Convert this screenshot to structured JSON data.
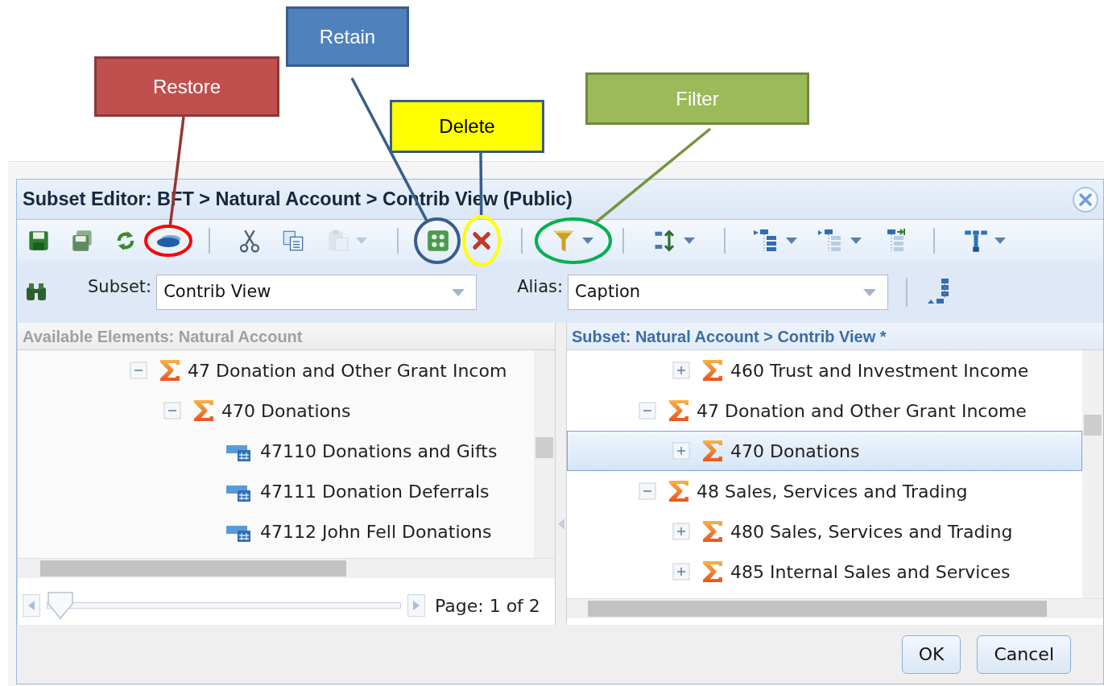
{
  "window": {
    "title": "Subset Editor: BFT > Natural Account > Contrib View (Public)"
  },
  "toolbar": [
    {
      "kind": "save",
      "dropdown": false,
      "disabled": false
    },
    {
      "kind": "saveas",
      "dropdown": false,
      "disabled": false
    },
    {
      "kind": "refresh",
      "dropdown": false,
      "disabled": false
    },
    {
      "kind": "restore",
      "dropdown": false,
      "disabled": false
    },
    {
      "kind": "separator"
    },
    {
      "kind": "cut",
      "dropdown": false,
      "disabled": false
    },
    {
      "kind": "copy",
      "dropdown": false,
      "disabled": false
    },
    {
      "kind": "paste",
      "dropdown": true,
      "disabled": true
    },
    {
      "kind": "separator"
    },
    {
      "kind": "retain",
      "dropdown": false,
      "disabled": false
    },
    {
      "kind": "delete",
      "dropdown": false,
      "disabled": false
    },
    {
      "kind": "separator"
    },
    {
      "kind": "filter",
      "dropdown": true,
      "disabled": false
    },
    {
      "kind": "separator"
    },
    {
      "kind": "sort",
      "dropdown": true,
      "disabled": false
    },
    {
      "kind": "separator"
    },
    {
      "kind": "expand",
      "dropdown": true,
      "disabled": false
    },
    {
      "kind": "collapse",
      "dropdown": true,
      "disabled": false
    },
    {
      "kind": "insert",
      "dropdown": false,
      "disabled": false
    },
    {
      "kind": "separator"
    },
    {
      "kind": "hierarchy",
      "dropdown": true,
      "disabled": false
    }
  ],
  "subset_row": {
    "subset_label": "Subset:",
    "subset_value": "Contrib View",
    "alias_label": "Alias:",
    "alias_value": "Caption"
  },
  "available_panel": {
    "header": "Available Elements: Natural Account",
    "tree": [
      {
        "label": "47 Donation and Other Grant Incom",
        "kind": "consolidated",
        "expanded": true,
        "selected": false,
        "children": [
          {
            "label": "470 Donations",
            "kind": "consolidated",
            "expanded": true,
            "selected": false,
            "children": [
              {
                "label": "47110 Donations and Gifts",
                "kind": "leaf",
                "selected": false
              },
              {
                "label": "47111 Donation Deferrals",
                "kind": "leaf",
                "selected": false
              },
              {
                "label": "47112 John Fell Donations",
                "kind": "leaf",
                "selected": false
              }
            ]
          }
        ]
      }
    ]
  },
  "pager": {
    "level": 0,
    "text": "Page: 1 of 2"
  },
  "subset_panel": {
    "header": "Subset: Natural Account > Contrib View *",
    "tree": [
      {
        "children": [
          {
            "label": "460 Trust and Investment Income",
            "kind": "consolidated",
            "expanded": false,
            "selected": false
          }
        ]
      },
      {
        "label": "47 Donation and Other Grant Income",
        "kind": "consolidated",
        "expanded": true,
        "selected": false,
        "children": [
          {
            "label": "470 Donations",
            "kind": "consolidated",
            "expanded": false,
            "selected": true
          }
        ]
      },
      {
        "label": "48 Sales, Services and Trading",
        "kind": "consolidated",
        "expanded": true,
        "selected": false,
        "children": [
          {
            "label": "480 Sales, Services and Trading",
            "kind": "consolidated",
            "expanded": false,
            "selected": false
          },
          {
            "label": "485 Internal Sales and Services",
            "kind": "consolidated",
            "expanded": false,
            "selected": false
          }
        ]
      }
    ]
  },
  "buttons": [
    "OK",
    "Cancel"
  ],
  "callouts": [
    {
      "kind": "restore",
      "label": "Restore",
      "color": "#c0504d"
    },
    {
      "kind": "retain",
      "label": "Retain",
      "color": "#4f81bd"
    },
    {
      "kind": "delete",
      "label": "Delete",
      "color": "#ffff00"
    },
    {
      "kind": "filter",
      "label": "Filter",
      "color": "#9bbb59"
    }
  ]
}
